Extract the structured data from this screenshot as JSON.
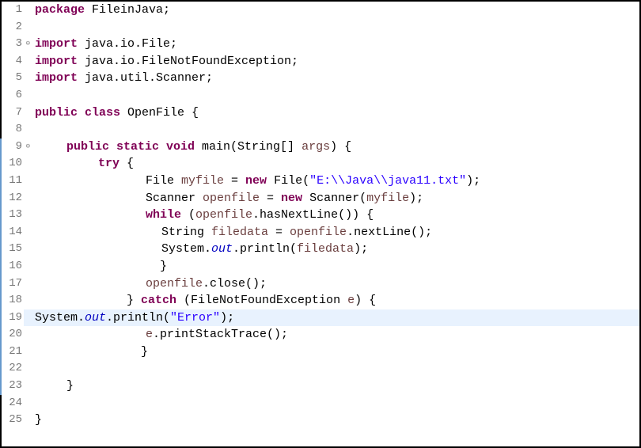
{
  "lines": [
    {
      "num": "1",
      "marked": false,
      "fold": false,
      "cls": "",
      "tokens": [
        {
          "t": "kw",
          "v": "package"
        },
        {
          "t": "normal",
          "v": " FileinJava;"
        }
      ]
    },
    {
      "num": "2",
      "marked": false,
      "fold": false,
      "cls": "",
      "tokens": []
    },
    {
      "num": "3",
      "marked": false,
      "fold": true,
      "cls": "",
      "tokens": [
        {
          "t": "kw",
          "v": "import"
        },
        {
          "t": "normal",
          "v": " java.io.File;"
        }
      ]
    },
    {
      "num": "4",
      "marked": false,
      "fold": false,
      "cls": "",
      "tokens": [
        {
          "t": "kw",
          "v": "import"
        },
        {
          "t": "normal",
          "v": " java.io.FileNotFoundException;"
        }
      ]
    },
    {
      "num": "5",
      "marked": false,
      "fold": false,
      "cls": "",
      "tokens": [
        {
          "t": "kw",
          "v": "import"
        },
        {
          "t": "normal",
          "v": " java.util.Scanner;"
        }
      ]
    },
    {
      "num": "6",
      "marked": false,
      "fold": false,
      "cls": "",
      "tokens": []
    },
    {
      "num": "7",
      "marked": false,
      "fold": false,
      "cls": "",
      "tokens": [
        {
          "t": "kw",
          "v": "public class"
        },
        {
          "t": "normal",
          "v": " OpenFile {"
        }
      ]
    },
    {
      "num": "8",
      "marked": false,
      "fold": false,
      "cls": "",
      "tokens": []
    },
    {
      "num": "9",
      "marked": true,
      "fold": true,
      "cls": "indent1",
      "tokens": [
        {
          "t": "kw",
          "v": "public static void"
        },
        {
          "t": "normal",
          "v": " main(String[] "
        },
        {
          "t": "local-var",
          "v": "args"
        },
        {
          "t": "normal",
          "v": ") {"
        }
      ]
    },
    {
      "num": "10",
      "marked": true,
      "fold": false,
      "cls": "indent2",
      "tokens": [
        {
          "t": "kw",
          "v": "try"
        },
        {
          "t": "normal",
          "v": " {"
        }
      ]
    },
    {
      "num": "11",
      "marked": true,
      "fold": false,
      "cls": "indent3",
      "tokens": [
        {
          "t": "normal",
          "v": "File "
        },
        {
          "t": "local-var",
          "v": "myfile"
        },
        {
          "t": "normal",
          "v": " = "
        },
        {
          "t": "kw",
          "v": "new"
        },
        {
          "t": "normal",
          "v": " File("
        },
        {
          "t": "str",
          "v": "\"E:\\\\Java\\\\java11.txt\""
        },
        {
          "t": "normal",
          "v": ");"
        }
      ]
    },
    {
      "num": "12",
      "marked": true,
      "fold": false,
      "cls": "indent3",
      "tokens": [
        {
          "t": "normal",
          "v": "Scanner "
        },
        {
          "t": "local-var",
          "v": "openfile"
        },
        {
          "t": "normal",
          "v": " = "
        },
        {
          "t": "kw",
          "v": "new"
        },
        {
          "t": "normal",
          "v": " Scanner("
        },
        {
          "t": "local-var",
          "v": "myfile"
        },
        {
          "t": "normal",
          "v": ");"
        }
      ]
    },
    {
      "num": "13",
      "marked": true,
      "fold": false,
      "cls": "indent3",
      "tokens": [
        {
          "t": "kw",
          "v": "while"
        },
        {
          "t": "normal",
          "v": " ("
        },
        {
          "t": "local-var",
          "v": "openfile"
        },
        {
          "t": "normal",
          "v": ".hasNextLine()) {"
        }
      ]
    },
    {
      "num": "14",
      "marked": true,
      "fold": false,
      "cls": "indent4",
      "tokens": [
        {
          "t": "normal",
          "v": "String "
        },
        {
          "t": "local-var",
          "v": "filedata"
        },
        {
          "t": "normal",
          "v": " = "
        },
        {
          "t": "local-var",
          "v": "openfile"
        },
        {
          "t": "normal",
          "v": ".nextLine();"
        }
      ]
    },
    {
      "num": "15",
      "marked": true,
      "fold": false,
      "cls": "indent4",
      "tokens": [
        {
          "t": "normal",
          "v": "System."
        },
        {
          "t": "static-field",
          "v": "out"
        },
        {
          "t": "normal",
          "v": ".println("
        },
        {
          "t": "local-var",
          "v": "filedata"
        },
        {
          "t": "normal",
          "v": ");"
        }
      ]
    },
    {
      "num": "16",
      "marked": true,
      "fold": false,
      "cls": "indent3",
      "tokens": [
        {
          "t": "normal",
          "v": "  }"
        }
      ]
    },
    {
      "num": "17",
      "marked": true,
      "fold": false,
      "cls": "indent3",
      "tokens": [
        {
          "t": "local-var",
          "v": "openfile"
        },
        {
          "t": "normal",
          "v": ".close();"
        }
      ]
    },
    {
      "num": "18",
      "marked": true,
      "fold": false,
      "cls": "indent2",
      "tokens": [
        {
          "t": "normal",
          "v": "    } "
        },
        {
          "t": "kw",
          "v": "catch"
        },
        {
          "t": "normal",
          "v": " (FileNotFoundException "
        },
        {
          "t": "local-var",
          "v": "e"
        },
        {
          "t": "normal",
          "v": ") {"
        }
      ]
    },
    {
      "num": "19",
      "marked": true,
      "fold": false,
      "cls": "indent3",
      "highlighted": true,
      "tokens": [
        {
          "t": "normal",
          "v": "System."
        },
        {
          "t": "static-field",
          "v": "out"
        },
        {
          "t": "normal",
          "v": ".println("
        },
        {
          "t": "str",
          "v": "\"Error\""
        },
        {
          "t": "normal",
          "v": ");"
        }
      ]
    },
    {
      "num": "20",
      "marked": true,
      "fold": false,
      "cls": "indent3",
      "tokens": [
        {
          "t": "local-var",
          "v": "e"
        },
        {
          "t": "normal",
          "v": ".printStackTrace();"
        }
      ]
    },
    {
      "num": "21",
      "marked": true,
      "fold": false,
      "cls": "indent2",
      "tokens": [
        {
          "t": "normal",
          "v": "      }"
        }
      ]
    },
    {
      "num": "22",
      "marked": true,
      "fold": false,
      "cls": "",
      "tokens": []
    },
    {
      "num": "23",
      "marked": true,
      "fold": false,
      "cls": "indent1",
      "tokens": [
        {
          "t": "normal",
          "v": "}"
        }
      ]
    },
    {
      "num": "24",
      "marked": false,
      "fold": false,
      "cls": "",
      "tokens": []
    },
    {
      "num": "25",
      "marked": false,
      "fold": false,
      "cls": "",
      "tokens": [
        {
          "t": "normal",
          "v": "}"
        }
      ]
    }
  ]
}
